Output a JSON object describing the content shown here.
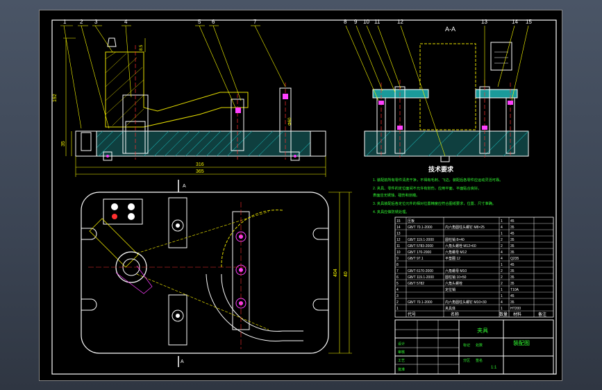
{
  "section_label": "A-A",
  "view_marker": "A",
  "callouts": [
    "1",
    "2",
    "3",
    "4",
    "5",
    "6",
    "7",
    "8",
    "9",
    "10",
    "11",
    "12",
    "13",
    "14",
    "15"
  ],
  "dimensions": {
    "overall_width_1": "316",
    "overall_width_2": "365",
    "height": "192",
    "base_h": "35",
    "plan_height": "404",
    "plan_height_2": "40",
    "hole_dia": "Φ60",
    "small_dim": "8.5"
  },
  "tech_requirements": {
    "title": "技术要求",
    "lines": [
      "1. 装配前所有零件清洗干净，不得有毛刺、飞边，装配后各零件应运动灵活可靠。",
      "2. 夹具、零件的定位面间不允许有划伤，应用平面、平面贴合良好。",
      "   表面应无锈蚀、碰伤和划痕。",
      "3. 夹具装配后各定位元件的相对位置精度应符合图纸要求，位置、尺寸准确。",
      "4. 夹具应做防锈处理。"
    ]
  },
  "bom": {
    "rows": [
      [
        "15",
        "压板",
        "",
        "1",
        "45"
      ],
      [
        "14",
        "GB/T 70.1-2000",
        "内六角圆柱头螺钉 M8×25",
        "4",
        "35"
      ],
      [
        "13",
        "",
        "",
        "1",
        "45"
      ],
      [
        "12",
        "GB/T 119.1-2000",
        "圆柱销 8×40",
        "2",
        "35"
      ],
      [
        "11",
        "GB/T 5783-2000",
        "六角头螺栓 M12×60",
        "2",
        "35"
      ],
      [
        "10",
        "GB/T 170-2000",
        "六角螺母 M12",
        "4",
        "35"
      ],
      [
        "9",
        "GB/T 97.1",
        "平垫圈 12",
        "4",
        "Q235"
      ],
      [
        "8",
        "",
        "",
        "1",
        "45"
      ],
      [
        "7",
        "GB/T 6170-2000",
        "六角螺母 M10",
        "2",
        "35"
      ],
      [
        "6",
        "GB/T 119.1-2000",
        "圆柱销 10×50",
        "2",
        "35"
      ],
      [
        "5",
        "GB/T 5782",
        "六角头螺栓",
        "2",
        "35"
      ],
      [
        "4",
        "",
        "定位销",
        "1",
        "T10A"
      ],
      [
        "3",
        "",
        "",
        "1",
        "45"
      ],
      [
        "2",
        "GB/T 70.1-2000",
        "内六角圆柱头螺钉 M10×30",
        "4",
        "35"
      ],
      [
        "1",
        "",
        "夹具体",
        "1",
        "HT200"
      ]
    ],
    "header": {
      "code": "代号",
      "name": "名称",
      "qty": "数量",
      "material": "材料",
      "remark": "备注"
    }
  },
  "title_block": {
    "title": "夹具",
    "drawing_no": "装配图",
    "scale": "1:1",
    "labels": [
      "设计",
      "审核",
      "工艺",
      "批准",
      "标记",
      "处数",
      "分区",
      "签名"
    ]
  }
}
